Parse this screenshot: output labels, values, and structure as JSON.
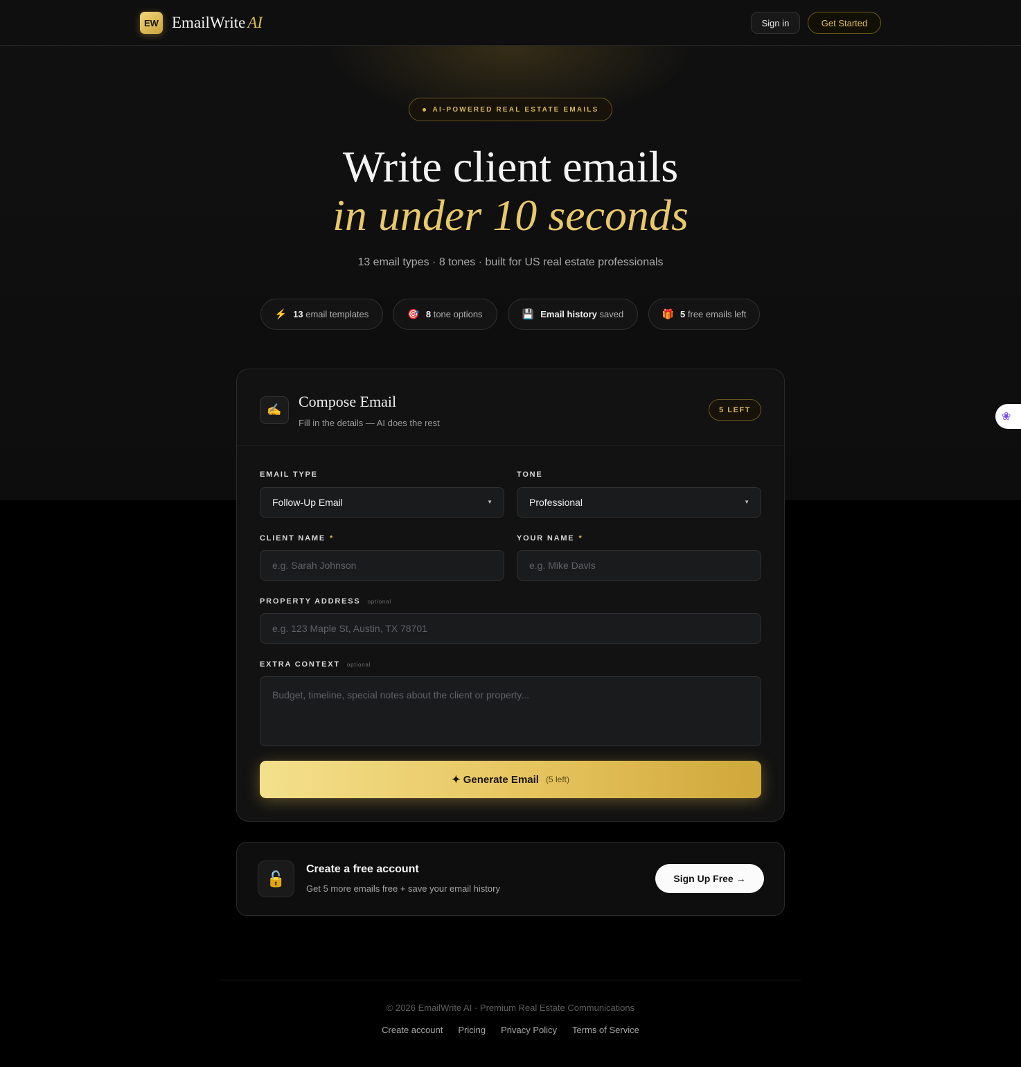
{
  "header": {
    "logo_badge": "EW",
    "brand_name": "EmailWrite",
    "brand_suffix": "AI",
    "sign_in": "Sign in",
    "get_started": "Get Started"
  },
  "hero": {
    "eyebrow": "AI-POWERED REAL ESTATE EMAILS",
    "headline_line1": "Write client emails",
    "headline_line2": "in under 10 seconds",
    "subtitle": "13 email types · 8 tones · built for US real estate professionals",
    "pills": [
      {
        "icon": "lightning-icon",
        "glyph": "⚡",
        "bold": "13",
        "text": "email templates"
      },
      {
        "icon": "target-icon",
        "glyph": "🎯",
        "bold": "8",
        "text": "tone options"
      },
      {
        "icon": "floppy-disk-icon",
        "glyph": "💾",
        "bold": "Email history",
        "text": "saved"
      },
      {
        "icon": "gift-icon",
        "glyph": "🎁",
        "bold": "5",
        "text": "free emails left"
      }
    ]
  },
  "compose": {
    "icon": "writing-hand-icon",
    "title": "Compose Email",
    "subtitle": "Fill in the details — AI does the rest",
    "remaining_badge": "5 LEFT",
    "email_type": {
      "label": "EMAIL TYPE",
      "value": "Follow-Up Email"
    },
    "tone": {
      "label": "TONE",
      "value": "Professional"
    },
    "client_name": {
      "label": "CLIENT NAME",
      "required": "*",
      "placeholder": "e.g. Sarah Johnson"
    },
    "your_name": {
      "label": "YOUR NAME",
      "required": "*",
      "placeholder": "e.g. Mike Davis"
    },
    "property_address": {
      "label": "PROPERTY ADDRESS",
      "optional": "optional",
      "placeholder": "e.g. 123 Maple St, Austin, TX 78701"
    },
    "extra_context": {
      "label": "EXTRA CONTEXT",
      "optional": "optional",
      "placeholder": "Budget, timeline, special notes about the client or property..."
    },
    "generate_label": "✦ Generate Email",
    "generate_remaining": "(5 left)"
  },
  "account_cta": {
    "icon": "unlock-icon",
    "title": "Create a free account",
    "subtitle": "Get 5 more emails free + save your email history",
    "button": "Sign Up Free →"
  },
  "footer": {
    "copyright": "© 2026 EmailWrite AI · Premium Real Estate Communications",
    "links": [
      "Create account",
      "Pricing",
      "Privacy Policy",
      "Terms of Service"
    ]
  },
  "colors": {
    "accent_gold": "#e0bd5c",
    "background": "#000000",
    "card": "#121212"
  }
}
